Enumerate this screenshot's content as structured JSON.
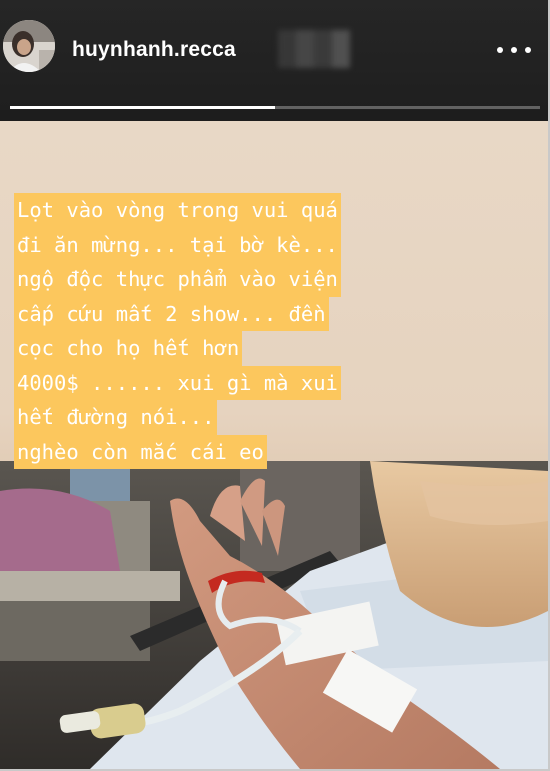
{
  "header": {
    "username": "huynhanh.recca",
    "progress": 0.5
  },
  "story": {
    "caption_lines": [
      "Lọt vào vòng trong vui quá",
      "đi ăn mừng... tại bờ kè...",
      "ngộ độc thực phẩm vào viện",
      "cấp cứu mất 2 show... đền",
      "cọc cho họ hết hơn",
      "4000$ ...... xui gì mà xui",
      "hết đường nói...",
      "nghèo còn mắc cái eo"
    ],
    "highlight_color": "#fcc75d"
  }
}
